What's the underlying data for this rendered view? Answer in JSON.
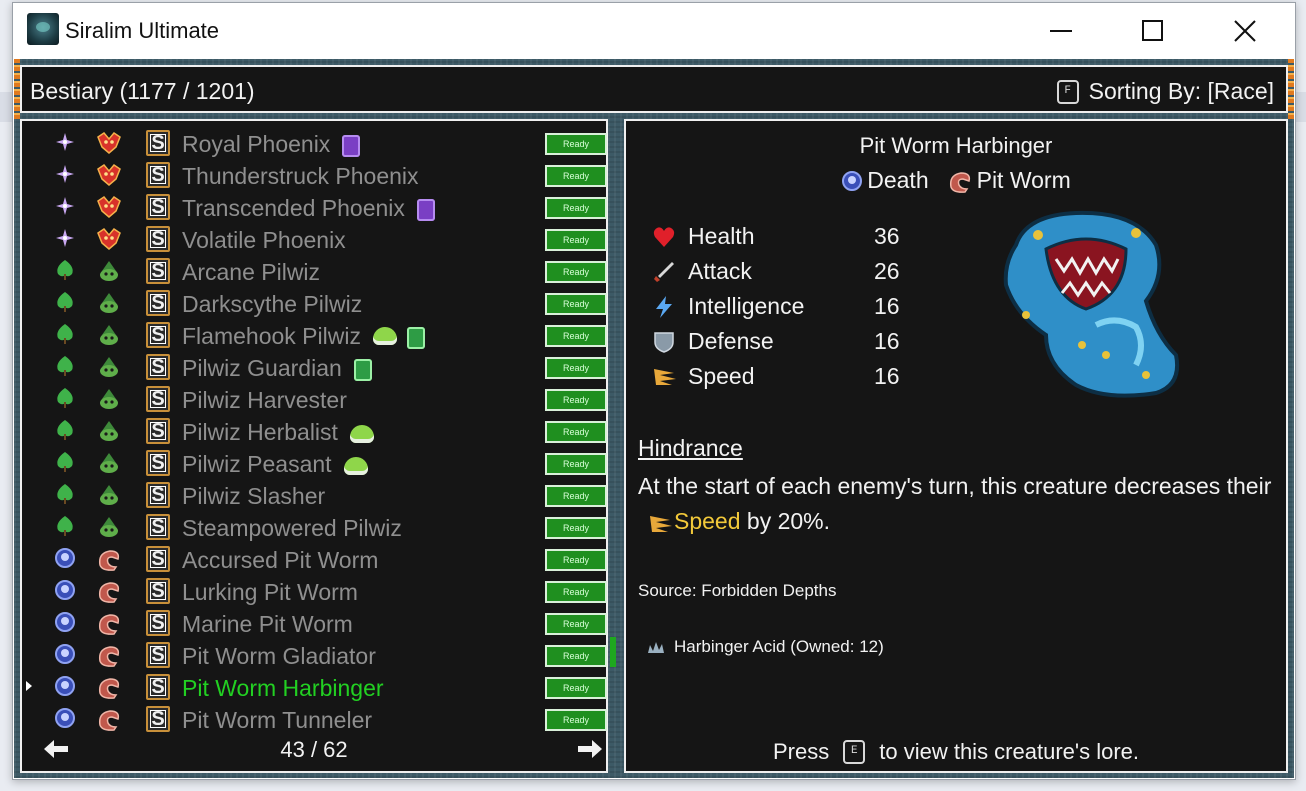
{
  "window": {
    "title": "Siralim Ultimate"
  },
  "header": {
    "title": "Bestiary (1177 / 1201)",
    "sort_key": "F",
    "sort_label": "Sorting By: [Race]"
  },
  "list": {
    "rows": [
      {
        "name": "Royal Phoenix",
        "element": "chaos",
        "race": "phoenix",
        "badges": [
          "purple"
        ],
        "status": "Ready",
        "selected": false
      },
      {
        "name": "Thunderstruck Phoenix",
        "element": "chaos",
        "race": "phoenix",
        "badges": [],
        "status": "Ready",
        "selected": false
      },
      {
        "name": "Transcended Phoenix",
        "element": "chaos",
        "race": "phoenix",
        "badges": [
          "purple"
        ],
        "status": "Ready",
        "selected": false
      },
      {
        "name": "Volatile Phoenix",
        "element": "chaos",
        "race": "phoenix",
        "badges": [],
        "status": "Ready",
        "selected": false
      },
      {
        "name": "Arcane Pilwiz",
        "element": "nature",
        "race": "pilwiz",
        "badges": [],
        "status": "Ready",
        "selected": false
      },
      {
        "name": "Darkscythe Pilwiz",
        "element": "nature",
        "race": "pilwiz",
        "badges": [],
        "status": "Ready",
        "selected": false
      },
      {
        "name": "Flamehook Pilwiz",
        "element": "nature",
        "race": "pilwiz",
        "badges": [
          "slime",
          "greencard"
        ],
        "status": "Ready",
        "selected": false
      },
      {
        "name": "Pilwiz Guardian",
        "element": "nature",
        "race": "pilwiz",
        "badges": [
          "greencard"
        ],
        "status": "Ready",
        "selected": false
      },
      {
        "name": "Pilwiz Harvester",
        "element": "nature",
        "race": "pilwiz",
        "badges": [],
        "status": "Ready",
        "selected": false
      },
      {
        "name": "Pilwiz Herbalist",
        "element": "nature",
        "race": "pilwiz",
        "badges": [
          "slime"
        ],
        "status": "Ready",
        "selected": false
      },
      {
        "name": "Pilwiz Peasant",
        "element": "nature",
        "race": "pilwiz",
        "badges": [
          "slime"
        ],
        "status": "Ready",
        "selected": false
      },
      {
        "name": "Pilwiz Slasher",
        "element": "nature",
        "race": "pilwiz",
        "badges": [],
        "status": "Ready",
        "selected": false
      },
      {
        "name": "Steampowered Pilwiz",
        "element": "nature",
        "race": "pilwiz",
        "badges": [],
        "status": "Ready",
        "selected": false
      },
      {
        "name": "Accursed Pit Worm",
        "element": "death",
        "race": "pitworm",
        "badges": [],
        "status": "Ready",
        "selected": false
      },
      {
        "name": "Lurking Pit Worm",
        "element": "death",
        "race": "pitworm",
        "badges": [],
        "status": "Ready",
        "selected": false
      },
      {
        "name": "Marine Pit Worm",
        "element": "death",
        "race": "pitworm",
        "badges": [],
        "status": "Ready",
        "selected": false
      },
      {
        "name": "Pit Worm Gladiator",
        "element": "death",
        "race": "pitworm",
        "badges": [],
        "status": "Ready",
        "selected": false
      },
      {
        "name": "Pit Worm Harbinger",
        "element": "death",
        "race": "pitworm",
        "badges": [],
        "status": "Ready",
        "selected": true
      },
      {
        "name": "Pit Worm Tunneler",
        "element": "death",
        "race": "pitworm",
        "badges": [],
        "status": "Ready",
        "selected": false
      }
    ],
    "page": "43 / 62"
  },
  "detail": {
    "name": "Pit Worm Harbinger",
    "element": "Death",
    "race": "Pit Worm",
    "stats": [
      {
        "label": "Health",
        "value": "36",
        "icon": "heart-icon"
      },
      {
        "label": "Attack",
        "value": "26",
        "icon": "sword-icon"
      },
      {
        "label": "Intelligence",
        "value": "16",
        "icon": "lightning-icon"
      },
      {
        "label": "Defense",
        "value": "16",
        "icon": "shield-icon"
      },
      {
        "label": "Speed",
        "value": "16",
        "icon": "wing-icon"
      }
    ],
    "trait_name": "Hindrance",
    "trait_pre": "At the start of each enemy's turn, this creature decreases their",
    "trait_keyword": "Speed",
    "trait_post": "by 20%.",
    "source": "Source: Forbidden Depths",
    "material": "Harbinger Acid (Owned: 12)",
    "lore_pre": "Press",
    "lore_key": "E",
    "lore_post": "to view this creature's lore."
  },
  "colors": {
    "panel_bg": "#151515",
    "selected_name": "#22d022",
    "unselected_name": "#8f8f8f",
    "ready_bg": "#1f8f1f",
    "speed_keyword": "#f2c93a"
  }
}
